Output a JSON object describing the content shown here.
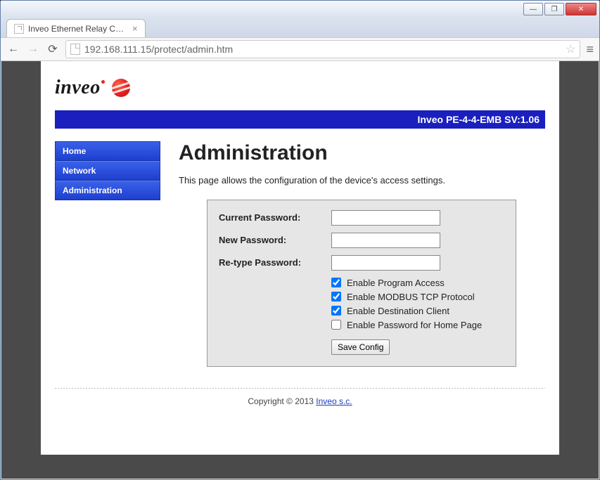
{
  "window": {
    "tab_title": "Inveo Ethernet Relay Cont",
    "address": "192.168.111.15/protect/admin.htm"
  },
  "brand": {
    "name": "inveo"
  },
  "modelbar": "Inveo PE-4-4-EMB SV:1.06",
  "sidebar": {
    "items": [
      {
        "label": "Home"
      },
      {
        "label": "Network"
      },
      {
        "label": "Administration"
      }
    ]
  },
  "page": {
    "heading": "Administration",
    "intro": "This page allows the configuration of the device's access settings.",
    "fields": {
      "current_pw_label": "Current Password:",
      "new_pw_label": "New Password:",
      "retype_pw_label": "Re-type Password:",
      "current_pw_value": "",
      "new_pw_value": "",
      "retype_pw_value": ""
    },
    "checks": [
      {
        "label": "Enable Program Access",
        "checked": true
      },
      {
        "label": "Enable MODBUS TCP Protocol",
        "checked": true
      },
      {
        "label": "Enable Destination Client",
        "checked": true
      },
      {
        "label": "Enable Password for Home Page",
        "checked": false
      }
    ],
    "save_label": "Save Config"
  },
  "footer": {
    "prefix": "Copyright © 2013 ",
    "link_text": "Inveo s.c."
  }
}
